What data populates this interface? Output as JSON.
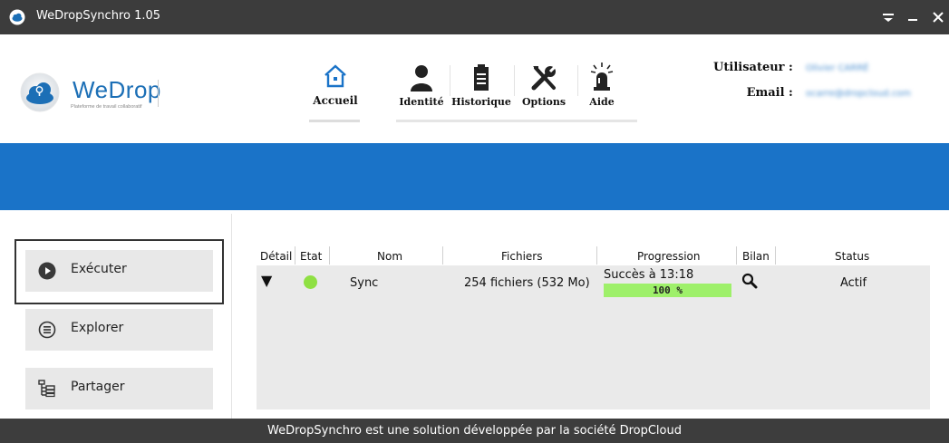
{
  "window": {
    "title": "WeDropSynchro 1.05",
    "menu_glyph": "▾",
    "min_glyph": "–",
    "close_glyph": "✕"
  },
  "brand": {
    "name": "WeDrop",
    "tagline": "Plateforme de travail collaboratif"
  },
  "nav": [
    {
      "label": "Accueil",
      "icon": "home-icon"
    },
    {
      "label": "Identité",
      "icon": "user-icon"
    },
    {
      "label": "Historique",
      "icon": "clipboard-icon"
    },
    {
      "label": "Options",
      "icon": "tools-icon"
    },
    {
      "label": "Aide",
      "icon": "alarm-icon"
    }
  ],
  "user": {
    "user_label": "Utilisateur :",
    "user_value": "Olivier CARRÉ",
    "email_label": "Email :",
    "email_value": "ocarre@dropcloud.com"
  },
  "actions": [
    {
      "label": "Exécuter",
      "icon": "play-icon"
    },
    {
      "label": "Explorer",
      "icon": "explore-icon"
    },
    {
      "label": "Partager",
      "icon": "tree-icon"
    }
  ],
  "table": {
    "headers": [
      "Détail",
      "Etat",
      "Nom",
      "Fichiers",
      "Progression",
      "Bilan",
      "Status"
    ],
    "rows": [
      {
        "detail": "▼",
        "state_color": "#8fe043",
        "name": "Sync",
        "files": "254 fichiers (532 Mo)",
        "progress_text": "Succès à 13:18",
        "progress_pct": "100 %",
        "progress_value": 1.0,
        "bilan_icon": "magnifier-icon",
        "status": "Actif"
      }
    ]
  },
  "footer": {
    "text": "WeDropSynchro est une solution développée par la société DropCloud"
  },
  "colors": {
    "band": "#1a73c8",
    "titlebar": "#3c3c3c",
    "progress": "#9ef06a",
    "brand": "#1c6fb6"
  }
}
